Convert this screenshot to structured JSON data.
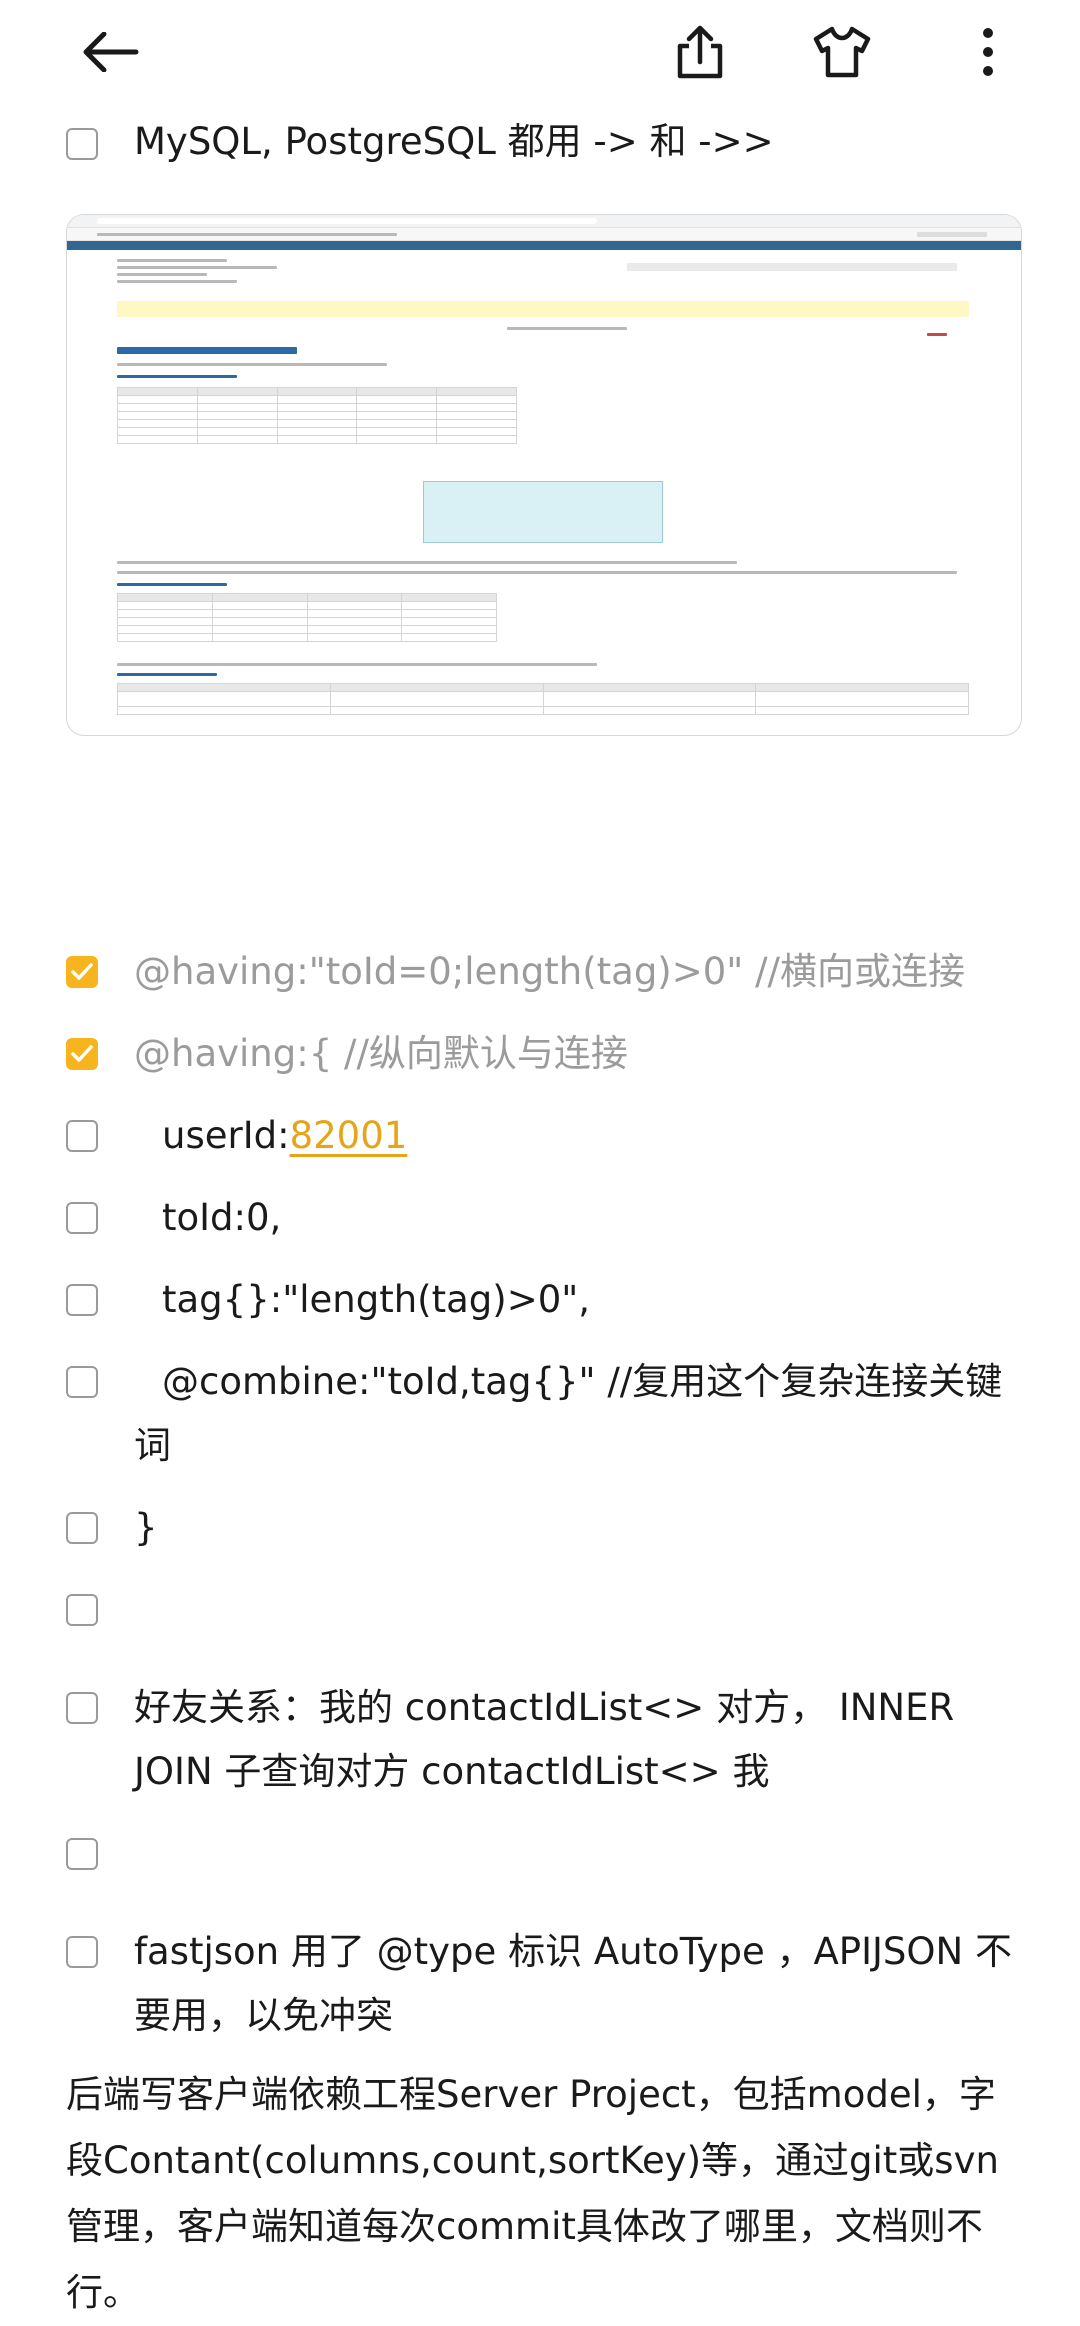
{
  "toolbar": {
    "back_icon": "arrow-left-icon",
    "share_icon": "share-icon",
    "theme_icon": "tshirt-icon",
    "more_icon": "more-vertical-icon"
  },
  "colors": {
    "accent": "#f6b51e",
    "link": "#e6a419",
    "done_text": "#9b9b9b"
  },
  "items": [
    {
      "checked": false,
      "text": "MySQL, PostgreSQL 都用 -> 和 ->>"
    },
    {
      "checked": true,
      "text": "@having:\"toId=0;length(tag)>0\"  //横向或连接"
    },
    {
      "checked": true,
      "text": "@having:{  //纵向默认与连接"
    },
    {
      "checked": false,
      "prefix": "userId:",
      "link": "82001"
    },
    {
      "checked": false,
      "text": "toId:0,"
    },
    {
      "checked": false,
      "text": "tag{}:\"length(tag)>0\","
    },
    {
      "checked": false,
      "text": "@combine:\"toId,tag{}\"  //复用这个复杂连接关键词"
    },
    {
      "checked": false,
      "text": "}"
    },
    {
      "checked": false,
      "text": ""
    },
    {
      "checked": false,
      "text": "好友关系：我的 contactIdList<> 对方， INNER JOIN 子查询对方 contactIdList<> 我"
    },
    {
      "checked": false,
      "text": ""
    },
    {
      "checked": false,
      "text": "fastjson 用了 @type 标识 AutoType ，APIJSON 不要用，以免冲突"
    }
  ],
  "paragraph": "后端写客户端依赖工程Server Project，包括model，字段Contant(columns,count,sortKey)等，通过git或svn管理，客户端知道每次commit具体改了哪里，文档则不行。"
}
